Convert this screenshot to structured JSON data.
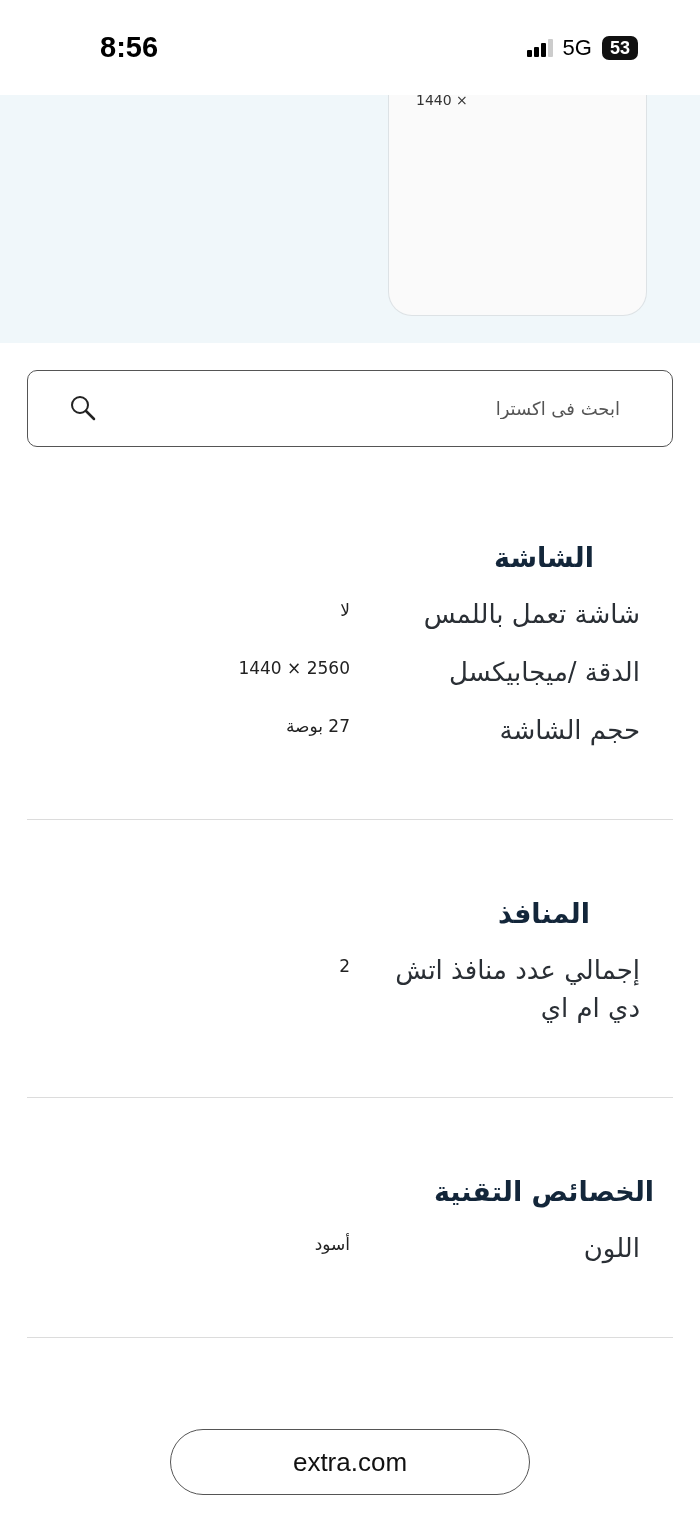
{
  "status_bar": {
    "time": "8:56",
    "network": "5G",
    "battery": "53"
  },
  "image_card": {
    "caption": "1440 ×"
  },
  "search": {
    "placeholder": "ابحث فى اكسترا"
  },
  "sections": [
    {
      "title": "الشاشة",
      "rows": [
        {
          "label": "شاشة تعمل باللمس",
          "value": "لا"
        },
        {
          "label": "الدقة /ميجابيكسل",
          "value": "2560 × 1440"
        },
        {
          "label": "حجم الشاشة",
          "value": "27 بوصة"
        }
      ]
    },
    {
      "title": "المنافذ",
      "rows": [
        {
          "label": "إجمالي عدد منافذ اتش دي ام اي",
          "value": "2"
        }
      ]
    },
    {
      "title": "الخصائص التقنية",
      "rows": [
        {
          "label": "اللون",
          "value": "أسود"
        }
      ]
    }
  ],
  "address_bar": {
    "url": "extra.com"
  }
}
